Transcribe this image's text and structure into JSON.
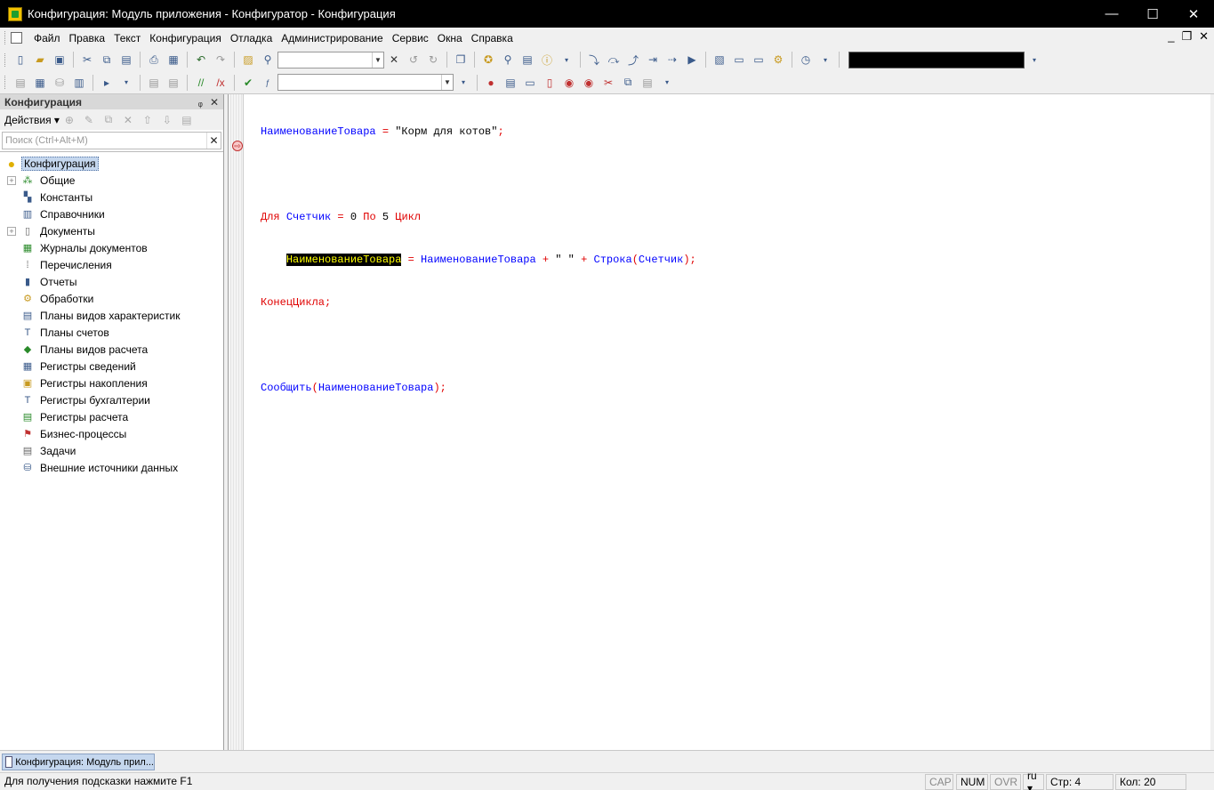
{
  "window": {
    "title": "Конфигурация: Модуль приложения - Конфигуратор - Конфигурация",
    "minimize": "—",
    "maximize": "☐",
    "close": "✕"
  },
  "menu": {
    "items": [
      "Файл",
      "Правка",
      "Текст",
      "Конфигурация",
      "Отладка",
      "Администрирование",
      "Сервис",
      "Окна",
      "Справка"
    ],
    "mdi_minimize": "_",
    "mdi_restore": "❐",
    "mdi_close": "✕"
  },
  "left_panel": {
    "title": "Конфигурация",
    "pin": "ᵩ",
    "close": "✕",
    "actions_label": "Действия ▾",
    "search_placeholder": "Поиск (Ctrl+Alt+M)",
    "search_clear": "✕",
    "root": "Конфигурация",
    "items": [
      {
        "label": "Общие",
        "expand": "+",
        "icon": "general-icon"
      },
      {
        "label": "Константы",
        "expand": "",
        "icon": "constants-icon"
      },
      {
        "label": "Справочники",
        "expand": "",
        "icon": "catalogs-icon"
      },
      {
        "label": "Документы",
        "expand": "+",
        "icon": "documents-icon"
      },
      {
        "label": "Журналы документов",
        "expand": "",
        "icon": "document-journals-icon"
      },
      {
        "label": "Перечисления",
        "expand": "",
        "icon": "enums-icon"
      },
      {
        "label": "Отчеты",
        "expand": "",
        "icon": "reports-icon"
      },
      {
        "label": "Обработки",
        "expand": "",
        "icon": "data-processors-icon"
      },
      {
        "label": "Планы видов характеристик",
        "expand": "",
        "icon": "characteristic-types-icon"
      },
      {
        "label": "Планы счетов",
        "expand": "",
        "icon": "charts-of-accounts-icon"
      },
      {
        "label": "Планы видов расчета",
        "expand": "",
        "icon": "calculation-types-icon"
      },
      {
        "label": "Регистры сведений",
        "expand": "",
        "icon": "information-registers-icon"
      },
      {
        "label": "Регистры накопления",
        "expand": "",
        "icon": "accumulation-registers-icon"
      },
      {
        "label": "Регистры бухгалтерии",
        "expand": "",
        "icon": "accounting-registers-icon"
      },
      {
        "label": "Регистры расчета",
        "expand": "",
        "icon": "calculation-registers-icon"
      },
      {
        "label": "Бизнес-процессы",
        "expand": "",
        "icon": "business-processes-icon"
      },
      {
        "label": "Задачи",
        "expand": "",
        "icon": "tasks-icon"
      },
      {
        "label": "Внешние источники данных",
        "expand": "",
        "icon": "external-data-sources-icon"
      }
    ]
  },
  "code": {
    "line1_var": "НаименованиеТовара",
    "line1_eq": " = ",
    "line1_str": "\"Корм для котов\"",
    "line1_end": ";",
    "line3_for": "Для",
    "line3_var": "Счетчик",
    "line3_eq": " = ",
    "line3_from": "0",
    "line3_to": "По",
    "line3_max": "5",
    "line3_loop": "Цикл",
    "line4_hl": "НаименованиеТовара",
    "line4_eq": " = ",
    "line4_var": "НаименованиеТовара",
    "line4_plus1": " + ",
    "line4_str": "\" \"",
    "line4_plus2": " + ",
    "line4_func": "Строка",
    "line4_paren_open": "(",
    "line4_arg": "Счетчик",
    "line4_close": ");",
    "line5": "КонецЦикла;",
    "line7_func": "Сообщить",
    "line7_paren_open": "(",
    "line7_arg": "НаименованиеТовара",
    "line7_close": ");",
    "breakpoint_glyph": "⇨"
  },
  "taskbar": {
    "window_tab": "Конфигурация: Модуль прил..."
  },
  "status": {
    "hint": "Для получения подсказки нажмите F1",
    "cap": "CAP",
    "num": "NUM",
    "ovr": "OVR",
    "lang": "ru ▾",
    "row": "Стр: 4",
    "col": "Кол: 20"
  },
  "colors": {
    "keyword": "#e00000",
    "identifier": "#0000ff",
    "highlight_bg": "#000000",
    "highlight_fg": "#ffff00"
  }
}
